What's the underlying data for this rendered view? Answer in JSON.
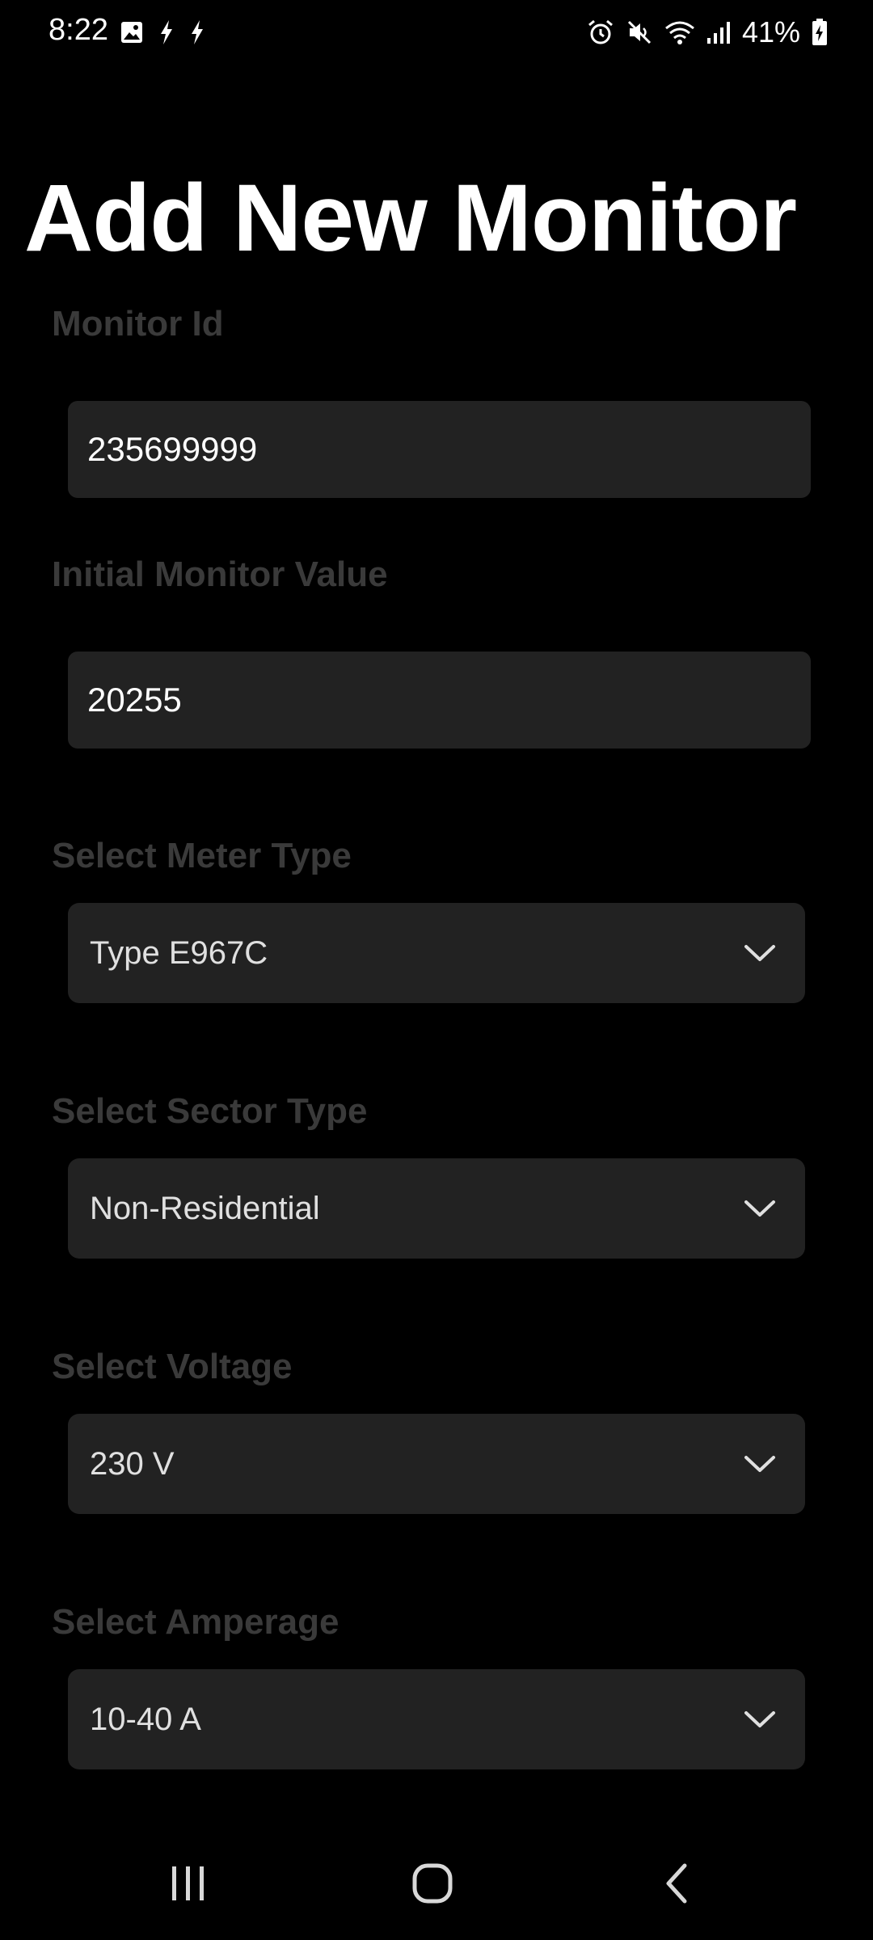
{
  "status_bar": {
    "time": "8:22",
    "battery_percent": "41%",
    "left_icons": [
      "gallery-icon",
      "bolt-icon",
      "bolt-icon"
    ],
    "right_icons": [
      "alarm-icon",
      "mute-icon",
      "wifi-icon",
      "signal-icon",
      "battery-charging-icon"
    ]
  },
  "page": {
    "title": "Add New Monitor"
  },
  "form": {
    "monitor_id": {
      "label": "Monitor Id",
      "value": "235699999"
    },
    "initial_value": {
      "label": "Initial Monitor Value",
      "value": "20255"
    },
    "meter_type": {
      "label": "Select Meter Type",
      "selected": "Type E967C"
    },
    "sector_type": {
      "label": "Select Sector Type",
      "selected": "Non-Residential"
    },
    "voltage": {
      "label": "Select Voltage",
      "selected": "230 V"
    },
    "amperage": {
      "label": "Select Amperage",
      "selected": "10-40 A"
    }
  },
  "nav_bar": {
    "buttons": [
      "recent-apps-icon",
      "home-icon",
      "back-icon"
    ]
  },
  "colors": {
    "background": "#000000",
    "field_background": "#222222",
    "label_color": "#3a3a3a",
    "text_color": "#ffffff"
  }
}
